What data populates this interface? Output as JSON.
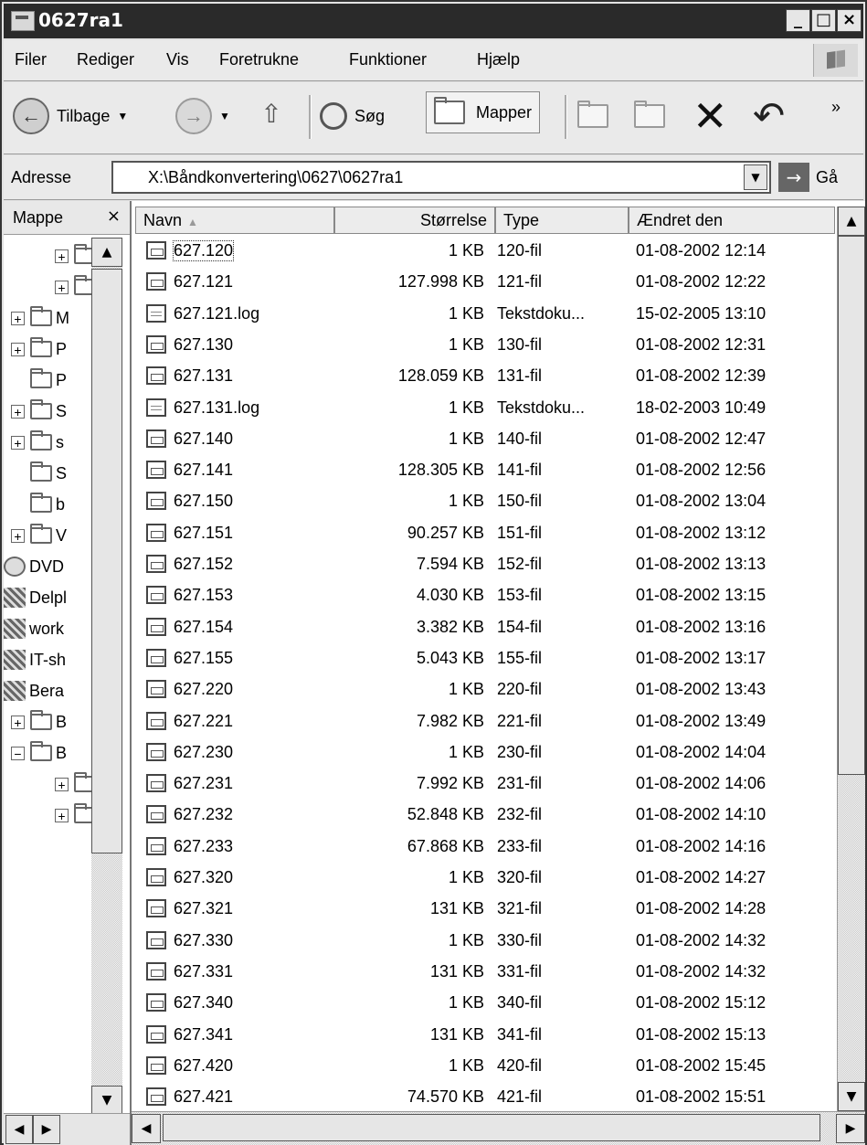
{
  "window": {
    "title": "0627ra1",
    "minimize": "_",
    "maximize": "□",
    "close": "×"
  },
  "menu": [
    "Filer",
    "Rediger",
    "Vis",
    "Foretrukne",
    "Funktioner",
    "Hjælp"
  ],
  "toolbar": {
    "back_label": "Tilbage",
    "search_label": "Søg",
    "folders_label": "Mapper",
    "more": "»"
  },
  "address": {
    "label": "Adresse",
    "value": "X:\\Båndkonvertering\\0627\\0627ra1",
    "go_label": "Gå"
  },
  "folders_pane": {
    "title": "Mappe",
    "close": "×",
    "items": [
      {
        "label": "",
        "expand": "+",
        "kind": "folder"
      },
      {
        "label": "",
        "expand": "+",
        "kind": "folder"
      },
      {
        "label": "M",
        "expand": "+",
        "kind": "folder"
      },
      {
        "label": "P",
        "expand": "+",
        "kind": "folder"
      },
      {
        "label": "P",
        "expand": "",
        "kind": "folder"
      },
      {
        "label": "S",
        "expand": "+",
        "kind": "folder"
      },
      {
        "label": "s",
        "expand": "+",
        "kind": "folder"
      },
      {
        "label": "S",
        "expand": "",
        "kind": "folder"
      },
      {
        "label": "b",
        "expand": "",
        "kind": "folder"
      },
      {
        "label": "V",
        "expand": "+",
        "kind": "folder"
      },
      {
        "label": "DVD",
        "expand": "",
        "kind": "drive"
      },
      {
        "label": "Delpl",
        "expand": "",
        "kind": "net"
      },
      {
        "label": "work",
        "expand": "",
        "kind": "net"
      },
      {
        "label": "IT-sh",
        "expand": "",
        "kind": "net"
      },
      {
        "label": "Bera",
        "expand": "",
        "kind": "net"
      },
      {
        "label": "B",
        "expand": "+",
        "kind": "folder"
      },
      {
        "label": "B",
        "expand": "−",
        "kind": "folder"
      },
      {
        "label": "",
        "expand": "+",
        "kind": "folder"
      },
      {
        "label": "",
        "expand": "+",
        "kind": "folder"
      }
    ]
  },
  "columns": {
    "name": "Navn",
    "size": "Størrelse",
    "type": "Type",
    "modified": "Ændret den"
  },
  "files": [
    {
      "name": "627.120",
      "size": "1 KB",
      "type": "120-fil",
      "modified": "01-08-2002 12:14",
      "icon": "data"
    },
    {
      "name": "627.121",
      "size": "127.998 KB",
      "type": "121-fil",
      "modified": "01-08-2002 12:22",
      "icon": "data"
    },
    {
      "name": "627.121.log",
      "size": "1 KB",
      "type": "Tekstdoku...",
      "modified": "15-02-2005 13:10",
      "icon": "text"
    },
    {
      "name": "627.130",
      "size": "1 KB",
      "type": "130-fil",
      "modified": "01-08-2002 12:31",
      "icon": "data"
    },
    {
      "name": "627.131",
      "size": "128.059 KB",
      "type": "131-fil",
      "modified": "01-08-2002 12:39",
      "icon": "data"
    },
    {
      "name": "627.131.log",
      "size": "1 KB",
      "type": "Tekstdoku...",
      "modified": "18-02-2003 10:49",
      "icon": "text"
    },
    {
      "name": "627.140",
      "size": "1 KB",
      "type": "140-fil",
      "modified": "01-08-2002 12:47",
      "icon": "data"
    },
    {
      "name": "627.141",
      "size": "128.305 KB",
      "type": "141-fil",
      "modified": "01-08-2002 12:56",
      "icon": "data"
    },
    {
      "name": "627.150",
      "size": "1 KB",
      "type": "150-fil",
      "modified": "01-08-2002 13:04",
      "icon": "data"
    },
    {
      "name": "627.151",
      "size": "90.257 KB",
      "type": "151-fil",
      "modified": "01-08-2002 13:12",
      "icon": "data"
    },
    {
      "name": "627.152",
      "size": "7.594 KB",
      "type": "152-fil",
      "modified": "01-08-2002 13:13",
      "icon": "data"
    },
    {
      "name": "627.153",
      "size": "4.030 KB",
      "type": "153-fil",
      "modified": "01-08-2002 13:15",
      "icon": "data"
    },
    {
      "name": "627.154",
      "size": "3.382 KB",
      "type": "154-fil",
      "modified": "01-08-2002 13:16",
      "icon": "data"
    },
    {
      "name": "627.155",
      "size": "5.043 KB",
      "type": "155-fil",
      "modified": "01-08-2002 13:17",
      "icon": "data"
    },
    {
      "name": "627.220",
      "size": "1 KB",
      "type": "220-fil",
      "modified": "01-08-2002 13:43",
      "icon": "data"
    },
    {
      "name": "627.221",
      "size": "7.982 KB",
      "type": "221-fil",
      "modified": "01-08-2002 13:49",
      "icon": "data"
    },
    {
      "name": "627.230",
      "size": "1 KB",
      "type": "230-fil",
      "modified": "01-08-2002 14:04",
      "icon": "data"
    },
    {
      "name": "627.231",
      "size": "7.992 KB",
      "type": "231-fil",
      "modified": "01-08-2002 14:06",
      "icon": "data"
    },
    {
      "name": "627.232",
      "size": "52.848 KB",
      "type": "232-fil",
      "modified": "01-08-2002 14:10",
      "icon": "data"
    },
    {
      "name": "627.233",
      "size": "67.868 KB",
      "type": "233-fil",
      "modified": "01-08-2002 14:16",
      "icon": "data"
    },
    {
      "name": "627.320",
      "size": "1 KB",
      "type": "320-fil",
      "modified": "01-08-2002 14:27",
      "icon": "data"
    },
    {
      "name": "627.321",
      "size": "131 KB",
      "type": "321-fil",
      "modified": "01-08-2002 14:28",
      "icon": "data"
    },
    {
      "name": "627.330",
      "size": "1 KB",
      "type": "330-fil",
      "modified": "01-08-2002 14:32",
      "icon": "data"
    },
    {
      "name": "627.331",
      "size": "131 KB",
      "type": "331-fil",
      "modified": "01-08-2002 14:32",
      "icon": "data"
    },
    {
      "name": "627.340",
      "size": "1 KB",
      "type": "340-fil",
      "modified": "01-08-2002 15:12",
      "icon": "data"
    },
    {
      "name": "627.341",
      "size": "131 KB",
      "type": "341-fil",
      "modified": "01-08-2002 15:13",
      "icon": "data"
    },
    {
      "name": "627.420",
      "size": "1 KB",
      "type": "420-fil",
      "modified": "01-08-2002 15:45",
      "icon": "data"
    },
    {
      "name": "627.421",
      "size": "74.570 KB",
      "type": "421-fil",
      "modified": "01-08-2002 15:51",
      "icon": "data"
    }
  ]
}
